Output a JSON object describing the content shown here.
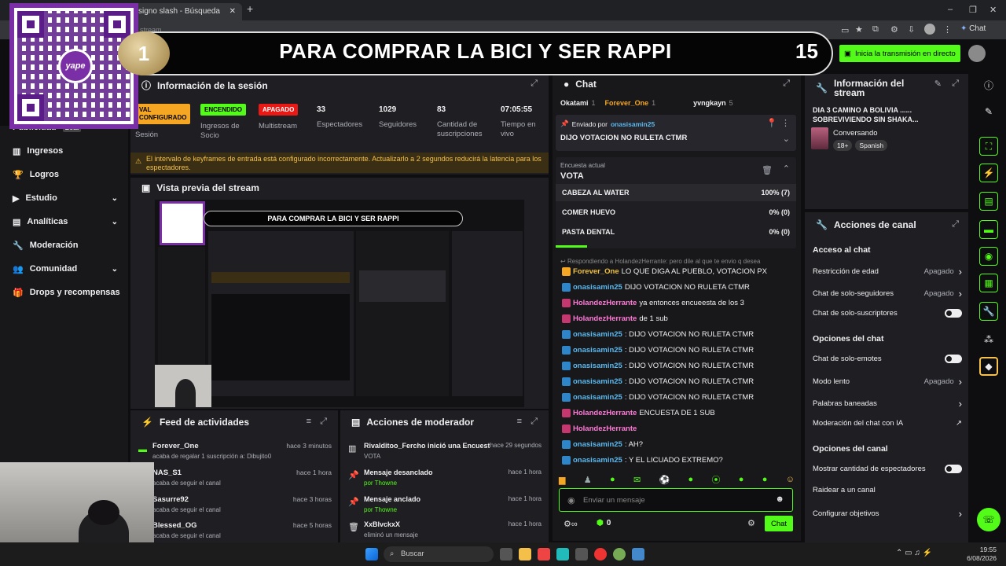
{
  "browser": {
    "tab_title": "signo slash - Búsqueda",
    "addr_text": "stream",
    "chat_btn": "Chat"
  },
  "banner": {
    "rank": "1",
    "title": "PARA COMPRAR LA BICI Y SER RAPPI",
    "number": "15"
  },
  "qr": {
    "brand": "yape"
  },
  "header": {
    "live_button": "Inicia la transmisión en directo"
  },
  "sidebar": {
    "items": [
      {
        "label": "Publicidad",
        "tag": "Beta"
      },
      {
        "label": "Ingresos"
      },
      {
        "label": "Logros"
      },
      {
        "label": "Estudio"
      },
      {
        "label": "Analíticas"
      },
      {
        "label": "Moderación"
      },
      {
        "label": "Comunidad"
      },
      {
        "label": "Drops y recompensas"
      }
    ]
  },
  "session": {
    "title": "Información de la sesión",
    "stats": [
      {
        "badge": "VAL\nCONFIGURADO",
        "label": "Sesión"
      },
      {
        "badge": "ENCENDIDO",
        "label": "Ingresos de Socio"
      },
      {
        "badge": "APAGADO",
        "label": "Multistream"
      },
      {
        "value": "33",
        "label": "Espectadores"
      },
      {
        "value": "1029",
        "label": "Seguidores"
      },
      {
        "value": "83",
        "label": "Cantidad de suscripciones"
      },
      {
        "value": "07:05:55",
        "label": "Tiempo en vivo"
      }
    ],
    "warning": "El intervalo de keyframes de entrada está configurado incorrectamente. Actualizarlo a 2 segundos reducirá la latencia para los espectadores."
  },
  "preview": {
    "title": "Vista previa del stream"
  },
  "feed": {
    "title": "Feed de actividades",
    "items": [
      {
        "user": "Forever_One",
        "time": "hace 3 minutos",
        "desc": "acaba de regalar 1 suscripción a: Dibujito0"
      },
      {
        "user": "NAS_S1",
        "time": "hace 1 hora",
        "desc": "acaba de seguir el canal"
      },
      {
        "user": "Sasurre92",
        "time": "hace 3 horas",
        "desc": "acaba de seguir el canal"
      },
      {
        "user": "Blessed_OG",
        "time": "hace 5 horas",
        "desc": "acaba de seguir el canal"
      }
    ]
  },
  "modactions": {
    "title": "Acciones de moderador",
    "items": [
      {
        "title": "Rivalditoo_Fercho inició una Encuesta",
        "time": "hace 29 segundos",
        "sub": "VOTA"
      },
      {
        "title": "Mensaje desanclado",
        "time": "hace 1 hora",
        "sub": "por Thowne"
      },
      {
        "title": "Mensaje anclado",
        "time": "hace 1 hora",
        "sub": "por Thowne"
      },
      {
        "title": "XxBlvckxX",
        "time": "hace 1 hora",
        "sub": "eliminó un mensaje"
      }
    ]
  },
  "chat": {
    "title": "Chat",
    "top_users": [
      {
        "name": "Okatami",
        "n": "1"
      },
      {
        "name": "Forever_One",
        "n": "1"
      },
      {
        "name": "yvngkayn",
        "n": "5"
      }
    ],
    "pinned_by_label": "Enviado por",
    "pinned_by": "onasisamin25",
    "pinned_text": "DIJO VOTACION NO RULETA CTMR",
    "poll_label": "Encuesta actual",
    "poll_title": "VOTA",
    "poll_options": [
      {
        "label": "CABEZA AL WATER",
        "result": "100% (7)",
        "pct": 100
      },
      {
        "label": "COMER HUEVO",
        "result": "0% (0)",
        "pct": 0
      },
      {
        "label": "PASTA DENTAL",
        "result": "0% (0)",
        "pct": 0
      }
    ],
    "reply_hint": "Respondiendo a HolandezHerrante: pero dile al que te envio q desea",
    "messages": [
      {
        "user": "Forever_One",
        "color": "#f0c040",
        "text": "LO QUE DIGA AL PUEBLO, VOTACION PX"
      },
      {
        "user": "onasisamin25",
        "color": "#5ab9ef",
        "text": "DIJO VOTACION NO RULETA CTMR"
      },
      {
        "user": "HolandezHerrante",
        "color": "#ff7ad6",
        "text": "ya entonces encueesta de los 3"
      },
      {
        "user": "HolandezHerrante",
        "color": "#ff7ad6",
        "text": "de 1 sub"
      },
      {
        "user": "onasisamin25",
        "color": "#5ab9ef",
        "text": ": DIJO VOTACION NO RULETA CTMR"
      },
      {
        "user": "onasisamin25",
        "color": "#5ab9ef",
        "text": ": DIJO VOTACION NO RULETA CTMR"
      },
      {
        "user": "onasisamin25",
        "color": "#5ab9ef",
        "text": ": DIJO VOTACION NO RULETA CTMR"
      },
      {
        "user": "onasisamin25",
        "color": "#5ab9ef",
        "text": ": DIJO VOTACION NO RULETA CTMR"
      },
      {
        "user": "onasisamin25",
        "color": "#5ab9ef",
        "text": ": DIJO VOTACION NO RULETA CTMR"
      },
      {
        "user": "HolandezHerrante",
        "color": "#ff7ad6",
        "text": "ENCUESTA DE 1 SUB"
      },
      {
        "user": "HolandezHerrante",
        "color": "#ff7ad6",
        "text": ""
      },
      {
        "user": "onasisamin25",
        "color": "#5ab9ef",
        "text": ": AH?"
      },
      {
        "user": "onasisamin25",
        "color": "#5ab9ef",
        "text": ": Y EL LICUADO EXTREMO?"
      }
    ],
    "input_placeholder": "Enviar un mensaje",
    "points": "0",
    "send_label": "Chat"
  },
  "streaminfo": {
    "title": "Información del stream",
    "stream_title": "DIA 3 CAMINO A BOLIVIA ...... SOBREVIVIENDO SIN SHAKA...",
    "category": "Conversando",
    "tags": [
      "18+",
      "Spanish"
    ]
  },
  "channel": {
    "title": "Acciones de canal",
    "sections": [
      {
        "head": "Acceso al chat",
        "rows": [
          {
            "label": "Restricción de edad",
            "value": "Apagado",
            "kind": "chevron"
          },
          {
            "label": "Chat de solo-seguidores",
            "value": "Apagado",
            "kind": "chevron"
          },
          {
            "label": "Chat de solo-suscriptores",
            "value": "",
            "kind": "toggle"
          }
        ]
      },
      {
        "head": "Opciones del chat",
        "rows": [
          {
            "label": "Chat de solo-emotes",
            "value": "",
            "kind": "toggle"
          },
          {
            "label": "Modo lento",
            "value": "Apagado",
            "kind": "chevron"
          },
          {
            "label": "Palabras baneadas",
            "value": "",
            "kind": "chevron"
          },
          {
            "label": "Moderación del chat con IA",
            "value": "",
            "kind": "ext"
          }
        ]
      },
      {
        "head": "Opciones del canal",
        "rows": [
          {
            "label": "Mostrar cantidad de espectadores",
            "value": "",
            "kind": "toggle"
          },
          {
            "label": "Raidear a un canal",
            "value": "",
            "kind": "none"
          },
          {
            "label": "Configurar objetivos",
            "value": "",
            "kind": "chevron"
          }
        ]
      }
    ]
  },
  "taskbar": {
    "search": "Buscar",
    "time": "19:55",
    "date": "6/08/2026"
  },
  "colors": {
    "accent": "#53fc18",
    "bg": "#0e0e10",
    "panel": "#1f1f23"
  }
}
